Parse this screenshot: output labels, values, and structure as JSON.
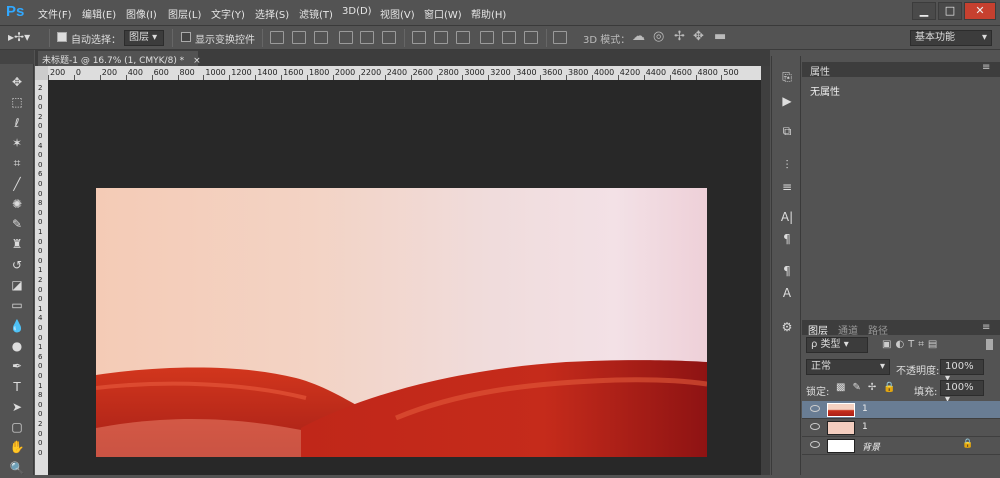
{
  "app": {
    "logo": "Ps"
  },
  "menu": [
    "文件(F)",
    "编辑(E)",
    "图像(I)",
    "图层(L)",
    "文字(Y)",
    "选择(S)",
    "滤镜(T)",
    "3D(D)",
    "视图(V)",
    "窗口(W)",
    "帮助(H)"
  ],
  "window_buttons": [
    "▁",
    "□",
    "✕"
  ],
  "options": {
    "auto_select_label": "自动选择：",
    "auto_select_value": "图层",
    "show_transform_label": "显示变换控件",
    "mode_3d_label": "3D 模式：",
    "workspace": "基本功能"
  },
  "document": {
    "tab_title": "未标题-1 @ 16.7% (1, CMYK/8) *",
    "close": "×"
  },
  "ruler": {
    "h_labels": [
      "200",
      "0",
      "200",
      "400",
      "600",
      "800",
      "1000",
      "1200",
      "1400",
      "1600",
      "1800",
      "2000",
      "2200",
      "2400",
      "2600",
      "2800",
      "3000",
      "3200",
      "3400",
      "3600",
      "3800",
      "4000",
      "4200",
      "4400",
      "4600",
      "4800",
      "500"
    ],
    "v_labels": [
      "2",
      "0",
      "0",
      "2",
      "0",
      "0",
      "4",
      "0",
      "0",
      "6",
      "0",
      "0",
      "8",
      "0",
      "0",
      "1",
      "0",
      "0",
      "0",
      "1",
      "2",
      "0",
      "0",
      "1",
      "4",
      "0",
      "0",
      "1",
      "6",
      "0",
      "0",
      "1",
      "8",
      "0",
      "0",
      "2",
      "0",
      "0",
      "0"
    ]
  },
  "tools": [
    {
      "name": "move-tool",
      "glyph": "✥"
    },
    {
      "name": "marquee-tool",
      "glyph": "⬚"
    },
    {
      "name": "lasso-tool",
      "glyph": "ℓ"
    },
    {
      "name": "magic-wand-tool",
      "glyph": "✶"
    },
    {
      "name": "crop-tool",
      "glyph": "⌗"
    },
    {
      "name": "eyedropper-tool",
      "glyph": "╱"
    },
    {
      "name": "healing-tool",
      "glyph": "✺"
    },
    {
      "name": "brush-tool",
      "glyph": "✎"
    },
    {
      "name": "stamp-tool",
      "glyph": "♜"
    },
    {
      "name": "history-brush-tool",
      "glyph": "↺"
    },
    {
      "name": "eraser-tool",
      "glyph": "◪"
    },
    {
      "name": "gradient-tool",
      "glyph": "▭"
    },
    {
      "name": "blur-tool",
      "glyph": "💧"
    },
    {
      "name": "dodge-tool",
      "glyph": "●"
    },
    {
      "name": "pen-tool",
      "glyph": "✒"
    },
    {
      "name": "type-tool",
      "glyph": "T"
    },
    {
      "name": "path-selection-tool",
      "glyph": "➤"
    },
    {
      "name": "shape-tool",
      "glyph": "▢"
    },
    {
      "name": "hand-tool",
      "glyph": "✋"
    },
    {
      "name": "zoom-tool",
      "glyph": "🔍"
    }
  ],
  "properties": {
    "tab": "属性",
    "content": "无属性"
  },
  "layers_panel": {
    "tabs": [
      "图层",
      "通道",
      "路径"
    ],
    "filter_label": "ρ 类型",
    "blend_mode": "正常",
    "opacity_label": "不透明度:",
    "opacity_value": "100%",
    "lock_label": "锁定:",
    "fill_label": "填充:",
    "fill_value": "100%",
    "layers": [
      {
        "name": "1",
        "selected": true
      },
      {
        "name": "1",
        "selected": false
      },
      {
        "name": "背景",
        "selected": false,
        "locked": true
      }
    ]
  },
  "colors": {
    "accent": "#31a8ff",
    "selected_layer": "#697d94",
    "canvas_bg": "#282828"
  }
}
